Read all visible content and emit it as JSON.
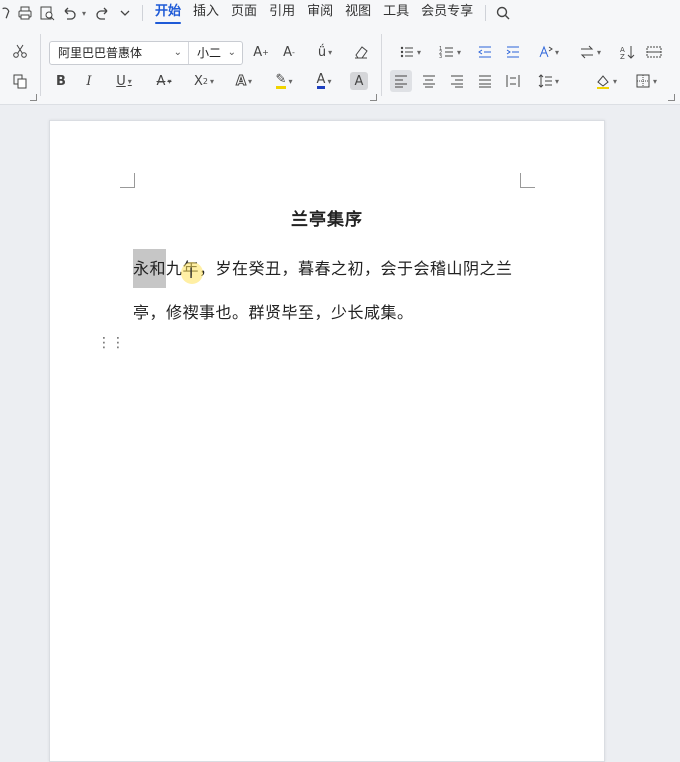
{
  "menu": {
    "tabs": [
      "开始",
      "插入",
      "页面",
      "引用",
      "审阅",
      "视图",
      "工具",
      "会员专享"
    ],
    "active_tab": "开始"
  },
  "ribbon": {
    "font_name": "阿里巴巴普惠体",
    "font_size": "小二",
    "accent_color": "#1e5ad7",
    "font_color_bar": "#1e3fbf",
    "highlight_bar": "#f1d400"
  },
  "document": {
    "title": "兰亭集序",
    "line1_selected": "永和",
    "line1_rest": "九年，岁在癸丑，暮春之初，会于会稽山阴之兰",
    "line2": "亭，修禊事也。群贤毕至，少长咸集。"
  }
}
